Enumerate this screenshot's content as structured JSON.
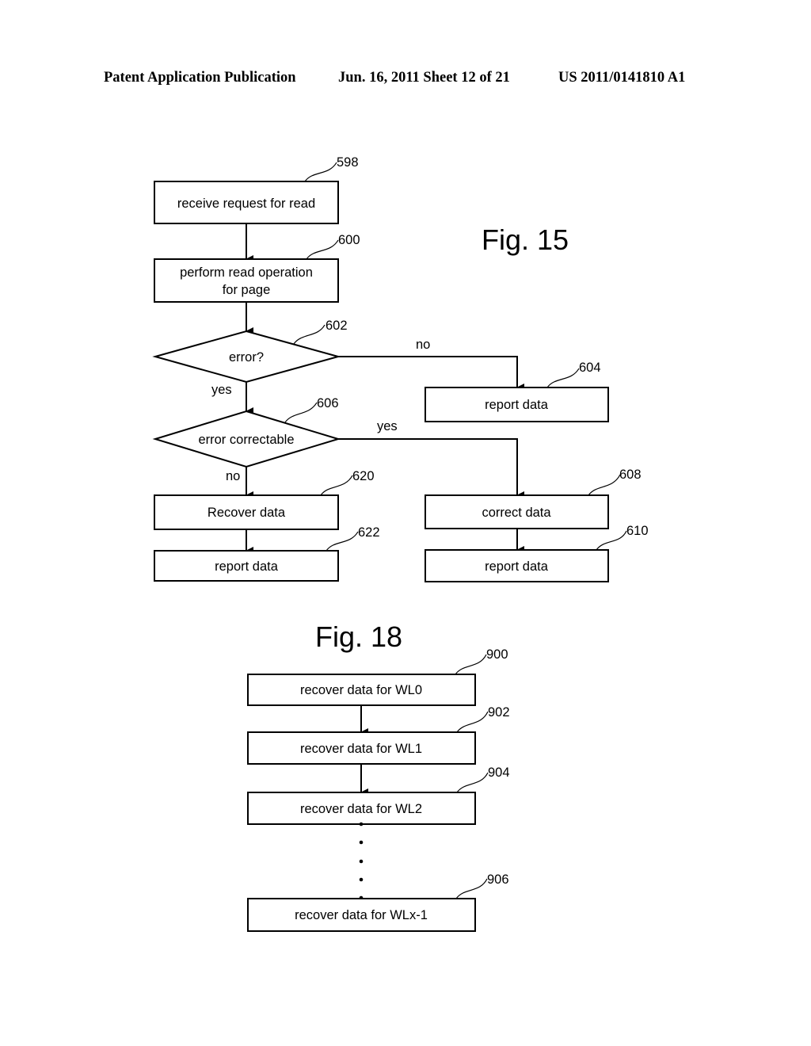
{
  "header": {
    "publication": "Patent Application Publication",
    "date_sheet": "Jun. 16, 2011  Sheet 12 of 21",
    "number": "US 2011/0141810 A1"
  },
  "fig15": {
    "title": "Fig. 15",
    "nodes": {
      "n598": {
        "ref": "598",
        "label": "receive request for read"
      },
      "n600": {
        "ref": "600",
        "line1": "perform read operation",
        "line2": "for page"
      },
      "n602": {
        "ref": "602",
        "label": "error?"
      },
      "n604": {
        "ref": "604",
        "label": "report data"
      },
      "n606": {
        "ref": "606",
        "label": "error correctable"
      },
      "n608": {
        "ref": "608",
        "label": "correct data"
      },
      "n610": {
        "ref": "610",
        "label": "report data"
      },
      "n620": {
        "ref": "620",
        "label": "Recover data"
      },
      "n622": {
        "ref": "622",
        "label": "report data"
      }
    },
    "edge_labels": {
      "e602_no": "no",
      "e602_yes": "yes",
      "e606_yes": "yes",
      "e606_no": "no"
    }
  },
  "fig18": {
    "title": "Fig. 18",
    "nodes": {
      "n900": {
        "ref": "900",
        "label": "recover data for WL0"
      },
      "n902": {
        "ref": "902",
        "label": "recover data for WL1"
      },
      "n904": {
        "ref": "904",
        "label": "recover data for WL2"
      },
      "n906": {
        "ref": "906",
        "label": "recover data for WLx-1"
      }
    }
  }
}
